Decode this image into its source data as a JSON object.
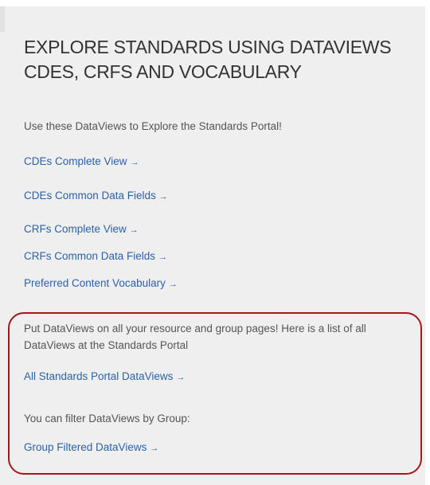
{
  "heading": "EXPLORE STANDARDS USING DATAVIEWS CDES, CRFS AND VOCABULARY",
  "intro": "Use these DataViews to Explore the Standards Portal!",
  "arrow": "→",
  "links": [
    {
      "label": "CDEs Complete View"
    },
    {
      "label": "CDEs Common Data Fields"
    },
    {
      "label": "CRFs Complete View"
    },
    {
      "label": "CRFs Common Data Fields"
    },
    {
      "label": "Preferred Content Vocabulary"
    }
  ],
  "highlight": {
    "text1": "Put DataViews on all your resource and group pages! Here is a list of all DataViews at the Standards Portal",
    "link1": "All Standards Portal DataViews",
    "text2": "You can filter DataViews by Group:",
    "link2": "Group Filtered DataViews"
  },
  "colors": {
    "link": "#2b62a8",
    "highlight_border": "#a3171e",
    "panel_background": "#efefef"
  }
}
